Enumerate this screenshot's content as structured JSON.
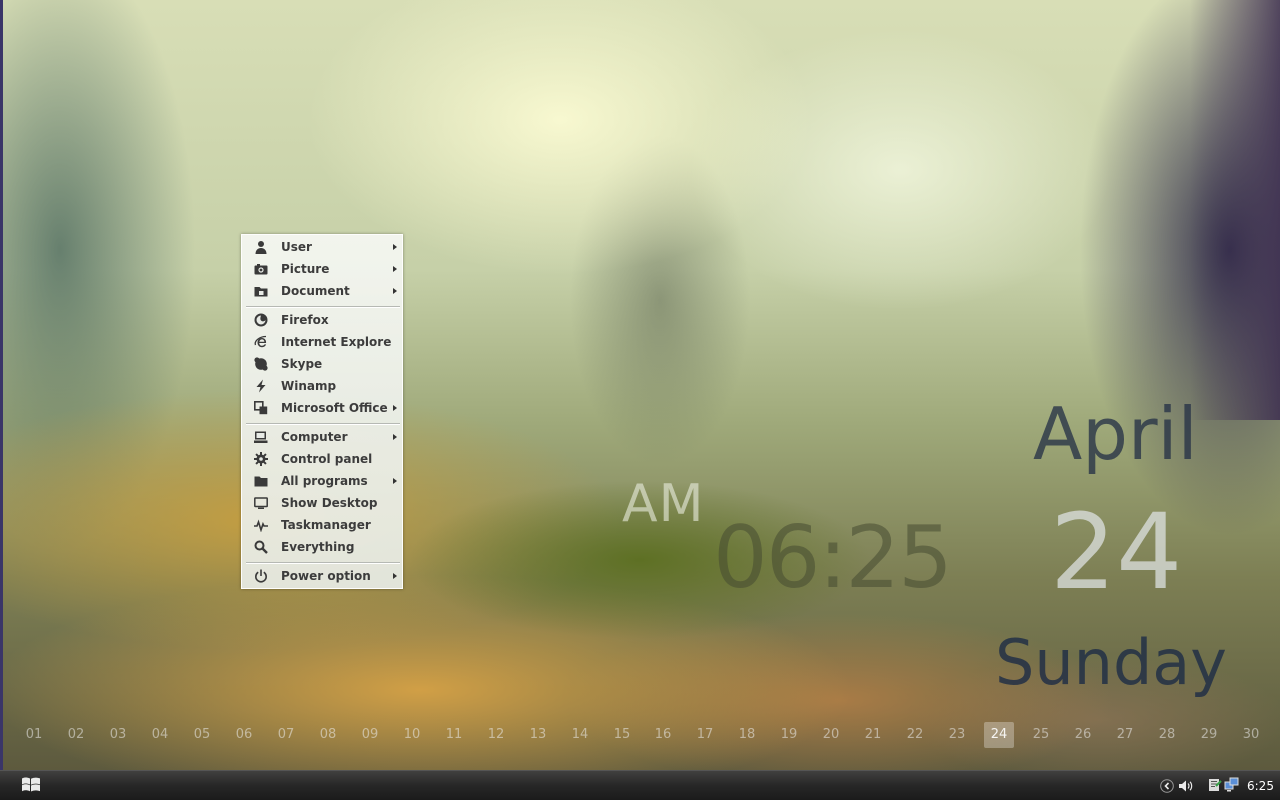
{
  "start_menu": {
    "items": [
      {
        "label": "User",
        "icon": "user-icon",
        "submenu": true
      },
      {
        "label": "Picture",
        "icon": "camera-icon",
        "submenu": true
      },
      {
        "label": "Document",
        "icon": "folder-document-icon",
        "submenu": true
      },
      {
        "label": "Firefox",
        "icon": "firefox-icon",
        "submenu": false
      },
      {
        "label": "Internet Explore",
        "icon": "internet-explorer-icon",
        "submenu": false
      },
      {
        "label": "Skype",
        "icon": "skype-icon",
        "submenu": false
      },
      {
        "label": "Winamp",
        "icon": "winamp-icon",
        "submenu": false
      },
      {
        "label": "Microsoft Office",
        "icon": "office-icon",
        "submenu": true
      },
      {
        "label": "Computer",
        "icon": "computer-icon",
        "submenu": true
      },
      {
        "label": "Control panel",
        "icon": "gear-icon",
        "submenu": false
      },
      {
        "label": "All programs",
        "icon": "folder-icon",
        "submenu": true
      },
      {
        "label": "Show Desktop",
        "icon": "monitor-icon",
        "submenu": false
      },
      {
        "label": "Taskmanager",
        "icon": "pulse-icon",
        "submenu": false
      },
      {
        "label": "Everything",
        "icon": "search-icon",
        "submenu": false
      },
      {
        "label": "Power option",
        "icon": "power-icon",
        "submenu": true
      }
    ]
  },
  "clock_widget": {
    "ampm": "AM",
    "time": "06:25"
  },
  "date_widget": {
    "month": "April",
    "day": "24",
    "weekday": "Sunday"
  },
  "day_strip": {
    "days": [
      "01",
      "02",
      "03",
      "04",
      "05",
      "06",
      "07",
      "08",
      "09",
      "10",
      "11",
      "12",
      "13",
      "14",
      "15",
      "16",
      "17",
      "18",
      "19",
      "20",
      "21",
      "22",
      "23",
      "24",
      "25",
      "26",
      "27",
      "28",
      "29",
      "30"
    ],
    "current": "24"
  },
  "taskbar": {
    "clock": "6:25",
    "start_icon": "windows-logo-icon",
    "tray_icons": [
      "chevron-left-icon",
      "volume-icon",
      "action-center-icon",
      "network-icon"
    ]
  }
}
